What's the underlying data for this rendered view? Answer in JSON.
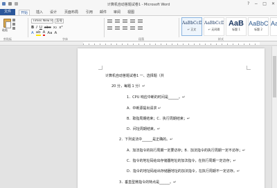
{
  "window": {
    "title": "计算机自动答题试卷1 - Microsoft Word",
    "controls": [
      "?",
      "−",
      "□",
      "✕"
    ]
  },
  "tabs": [
    {
      "label": "文件"
    },
    {
      "label": "开始"
    },
    {
      "label": "插入"
    },
    {
      "label": "设计"
    },
    {
      "label": "页面布局"
    },
    {
      "label": "引用"
    },
    {
      "label": "邮件"
    },
    {
      "label": "审阅"
    },
    {
      "label": "视图"
    }
  ],
  "ribbon": {
    "paste_label": "粘贴",
    "clipboard_group": "剪贴板",
    "font_name": "Times New R",
    "font_size": "五号",
    "font_group": "字体",
    "paragraph_group": "段落",
    "styles_group": "样式",
    "styles": [
      {
        "preview": "AaBbCcDc",
        "name": "↵ 正文"
      },
      {
        "preview": "AaBbCcDc",
        "name": "↵ 无间隔"
      },
      {
        "preview": "AaB",
        "name": "标题 1"
      },
      {
        "preview": "AaBbC",
        "name": "标题 2"
      },
      {
        "preview": "AaBbC",
        "name": "标题"
      }
    ]
  },
  "document": {
    "lines": [
      {
        "text": "计算机自动答题试卷1 一、选择题（共"
      },
      {
        "text": "20 分，每题 1 分）↵"
      },
      {
        "text": "1．CPU 响应中断的时间是______。↵"
      },
      {
        "text": "A．中断源提出请求 ↵"
      },
      {
        "text": "B．取指周期结束；C．执行周期结束；↵"
      },
      {
        "text": "D．间址周期结束。↵"
      },
      {
        "text": "2．下列说法中______是正确的。↵"
      },
      {
        "text": "A．加法指令的执行周期一定要访存；B．加法指令的执行周期一定不访存；↵"
      },
      {
        "text": "C．指令的地址码给出存储器地址的加法指令，在执行周期一定访存；↵"
      },
      {
        "text": "D．指令的地址码给出存储器地址的加法指令，在执行周期不一定访存。↵"
      },
      {
        "text": "3．垂直型微指令的特点是______。↵"
      }
    ]
  }
}
